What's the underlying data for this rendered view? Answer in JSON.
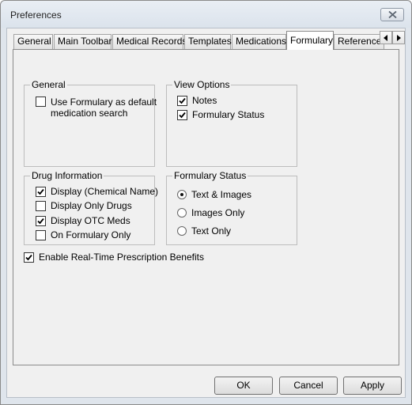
{
  "window": {
    "title": "Preferences"
  },
  "tabs": [
    {
      "label": "General",
      "active": false
    },
    {
      "label": "Main Toolbar",
      "active": false
    },
    {
      "label": "Medical Records",
      "active": false
    },
    {
      "label": "Templates",
      "active": false
    },
    {
      "label": "Medications",
      "active": false
    },
    {
      "label": "Formulary",
      "active": true
    },
    {
      "label": "Reference",
      "active": false
    }
  ],
  "groups": {
    "general": {
      "title": "General",
      "items": [
        {
          "label": "Use Formulary as default medication search",
          "checked": false
        }
      ]
    },
    "view_options": {
      "title": "View Options",
      "items": [
        {
          "label": "Notes",
          "checked": true
        },
        {
          "label": "Formulary Status",
          "checked": true
        }
      ]
    },
    "drug_information": {
      "title": "Drug Information",
      "items": [
        {
          "label": "Display (Chemical Name)",
          "checked": true
        },
        {
          "label": "Display Only Drugs",
          "checked": false
        },
        {
          "label": "Display OTC Meds",
          "checked": true
        },
        {
          "label": "On Formulary Only",
          "checked": false
        }
      ]
    },
    "formulary_status": {
      "title": "Formulary Status",
      "options": [
        {
          "label": "Text & Images",
          "selected": true
        },
        {
          "label": "Images Only",
          "selected": false
        },
        {
          "label": "Text Only",
          "selected": false
        }
      ]
    }
  },
  "realtime": {
    "label": "Enable Real-Time Prescription Benefits",
    "checked": true
  },
  "buttons": {
    "ok": "OK",
    "cancel": "Cancel",
    "apply": "Apply"
  }
}
